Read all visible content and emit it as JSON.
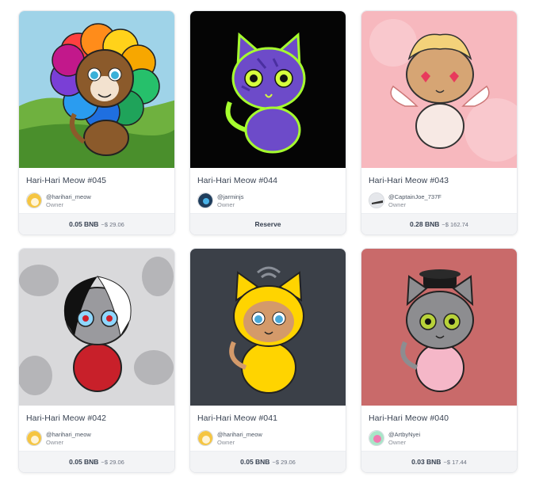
{
  "cards": [
    {
      "title": "Hari-Hari Meow #045",
      "handle": "@harihari_meow",
      "role": "Owner",
      "price": "0.05 BNB",
      "fiat": "~$ 29.06"
    },
    {
      "title": "Hari-Hari Meow #044",
      "handle": "@jarminjs",
      "role": "Owner",
      "action": "Reserve"
    },
    {
      "title": "Hari-Hari Meow #043",
      "handle": "@CaptainJoe_737F",
      "role": "Owner",
      "price": "0.28 BNB",
      "fiat": "~$ 162.74"
    },
    {
      "title": "Hari-Hari Meow #042",
      "handle": "@harihari_meow",
      "role": "Owner",
      "price": "0.05 BNB",
      "fiat": "~$ 29.06"
    },
    {
      "title": "Hari-Hari Meow #041",
      "handle": "@harihari_meow",
      "role": "Owner",
      "price": "0.05 BNB",
      "fiat": "~$ 29.06"
    },
    {
      "title": "Hari-Hari Meow #040",
      "handle": "@ArtbyNyei",
      "role": "Owner",
      "price": "0.03 BNB",
      "fiat": "~$ 17.44"
    }
  ],
  "colors": {
    "art_045_bg": "#9fd3e8",
    "art_044_bg": "#050505",
    "art_043_bg": "#f7b8be",
    "art_042_bg": "#d9d9db",
    "art_041_bg": "#3b4048",
    "art_040_bg": "#c96a6a"
  }
}
